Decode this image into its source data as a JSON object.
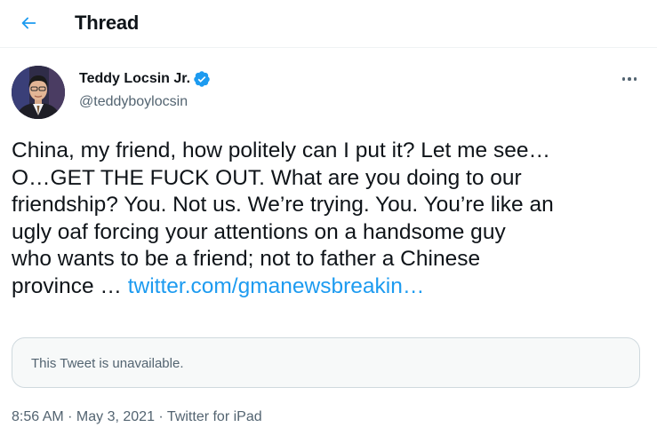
{
  "header": {
    "back_icon": "arrow-left-icon",
    "title": "Thread"
  },
  "tweet": {
    "author": {
      "name": "Teddy Locsin Jr.",
      "handle": "@teddyboylocsin",
      "verified": true,
      "verified_icon": "verified-badge-icon"
    },
    "more_icon": "more-horizontal-icon",
    "text_lines": [
      "China, my friend, how politely can I put it? Let me see…",
      "O…GET THE FUCK OUT. What are you doing to our",
      "friendship? You. Not us. We’re trying. You. You’re like an",
      "ugly oaf forcing your attentions on a handsome guy",
      "who wants to be a friend; not to father a Chinese",
      "province … "
    ],
    "link_text": "twitter.com/gmanewsbreakin…",
    "quoted_unavailable": "This Tweet is unavailable.",
    "time": "8:56 AM",
    "date": "May 3, 2021",
    "source": "Twitter for iPad",
    "separator": " · "
  },
  "colors": {
    "accent": "#1d9bf0",
    "text": "#0f1419",
    "secondary": "#536471",
    "border": "#cfd9de"
  }
}
